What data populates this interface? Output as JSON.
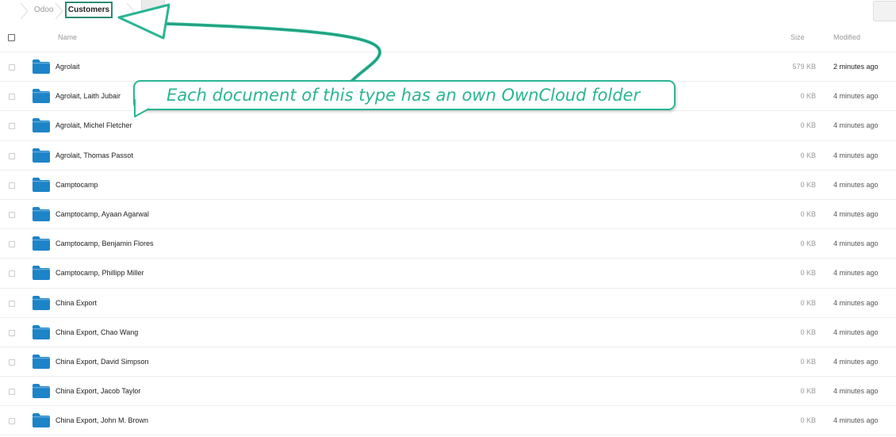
{
  "breadcrumb": {
    "items": [
      "Odoo",
      "Customers"
    ]
  },
  "table": {
    "headers": {
      "name": "Name",
      "size": "Size",
      "modified": "Modified"
    },
    "rows": [
      {
        "name": "Agrolait",
        "size": "579 KB",
        "modified": "2 minutes ago"
      },
      {
        "name": "Agrolait, Laith Jubair",
        "size": "0 KB",
        "modified": "4 minutes ago"
      },
      {
        "name": "Agrolait, Michel Fletcher",
        "size": "0 KB",
        "modified": "4 minutes ago"
      },
      {
        "name": "Agrolait, Thomas Passot",
        "size": "0 KB",
        "modified": "4 minutes ago"
      },
      {
        "name": "Camptocamp",
        "size": "0 KB",
        "modified": "4 minutes ago"
      },
      {
        "name": "Camptocamp, Ayaan Agarwal",
        "size": "0 KB",
        "modified": "4 minutes ago"
      },
      {
        "name": "Camptocamp, Benjamin Flores",
        "size": "0 KB",
        "modified": "4 minutes ago"
      },
      {
        "name": "Camptocamp, Phillipp Miller",
        "size": "0 KB",
        "modified": "4 minutes ago"
      },
      {
        "name": "China Export",
        "size": "0 KB",
        "modified": "4 minutes ago"
      },
      {
        "name": "China Export, Chao Wang",
        "size": "0 KB",
        "modified": "4 minutes ago"
      },
      {
        "name": "China Export, David Simpson",
        "size": "0 KB",
        "modified": "4 minutes ago"
      },
      {
        "name": "China Export, Jacob Taylor",
        "size": "0 KB",
        "modified": "4 minutes ago"
      },
      {
        "name": "China Export, John M. Brown",
        "size": "0 KB",
        "modified": "4 minutes ago"
      }
    ]
  },
  "annotation": {
    "text": "Each document of this type has an own OwnCloud folder"
  },
  "colors": {
    "folder": "#1d84c8",
    "annotation": "#2ab593",
    "breadcrumb_highlight": "#2a8c74"
  },
  "icons": {
    "folder": "folder-icon",
    "breadcrumb_separator": "chevron-right-icon"
  }
}
